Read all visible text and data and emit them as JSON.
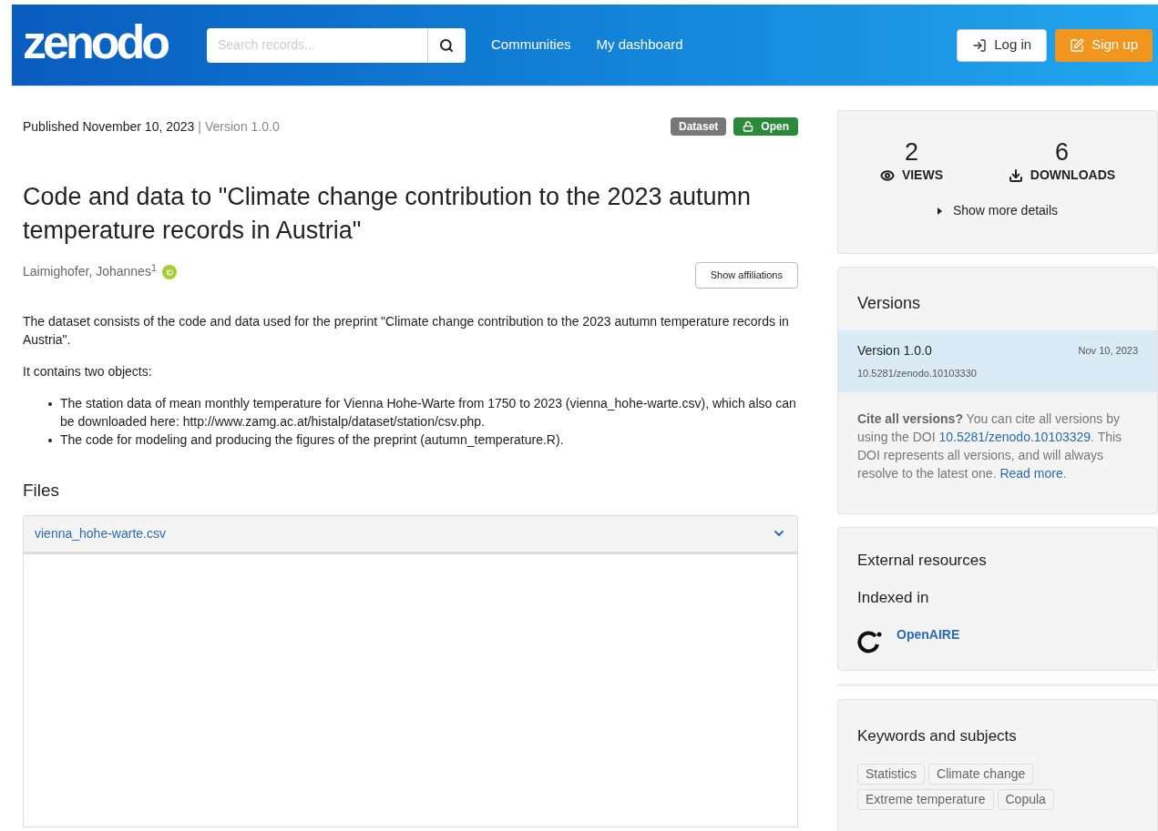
{
  "header": {
    "logo": "zenodo",
    "search": {
      "placeholder": "Search records..."
    },
    "nav": [
      "Communities",
      "My dashboard"
    ],
    "buttons": [
      {
        "kind": "login",
        "label": "Log in"
      },
      {
        "kind": "signup",
        "label": "Sign up"
      }
    ]
  },
  "record": {
    "published": "Published November 10, 2023",
    "separator": "|",
    "version": "Version 1.0.0",
    "badges": [
      {
        "kind": "type",
        "label": "Dataset"
      },
      {
        "kind": "access",
        "label": "Open"
      }
    ],
    "title": "Code and data to \"Climate change contribution to the 2023 autumn temperature records in Austria\"",
    "creator": {
      "name": "Laimighofer, Johannes",
      "mark": "1"
    },
    "affiliations_button": "Show affiliations",
    "description": [
      "The dataset consists of the code and data used for the preprint \"Climate change contribution to the 2023 autumn temperature records in Austria\".",
      "It contains two objects:"
    ],
    "bullets": [
      "The station data of mean monthly temperature for Vienna Hohe-Warte from 1750 to 2023 (vienna_hohe-warte.csv), which also can be downloaded here: http://www.zamg.ac.at/histalp/dataset/station/csv.php.",
      "The code for modeling and producing the figures of the preprint (autumn_temperature.R)."
    ]
  },
  "files": {
    "heading": "Files",
    "file": {
      "name": "vienna_hohe-warte.csv",
      "expanded": true
    }
  },
  "stats": {
    "items": [
      {
        "kind": "views",
        "count": "2",
        "label": "VIEWS"
      },
      {
        "kind": "downloads",
        "count": "6",
        "label": "DOWNLOADS"
      }
    ],
    "more": "Show more details"
  },
  "versions": {
    "heading": "Versions",
    "items": [
      {
        "label": "Version 1.0.0",
        "date": "Nov 10, 2023",
        "doi": "10.5281/zenodo.10103330",
        "selected": true
      }
    ],
    "cite": [
      {
        "kind": "bold",
        "text": "Cite all versions?"
      },
      {
        "kind": "text",
        "text": " You can cite all versions by using the DOI "
      },
      {
        "kind": "link",
        "text": "10.5281/zenodo.10103329"
      },
      {
        "kind": "text",
        "text": ". This DOI represents all versions, and will always resolve to the latest one. "
      },
      {
        "kind": "link",
        "text": "Read more"
      },
      {
        "kind": "text",
        "text": "."
      }
    ]
  },
  "external": {
    "heading": "External resources",
    "subheading": "Indexed in",
    "items": [
      "OpenAIRE"
    ]
  },
  "keywords": {
    "heading": "Keywords and subjects",
    "items": [
      "Statistics",
      "Climate change",
      "Extreme temperature",
      "Copula"
    ]
  }
}
